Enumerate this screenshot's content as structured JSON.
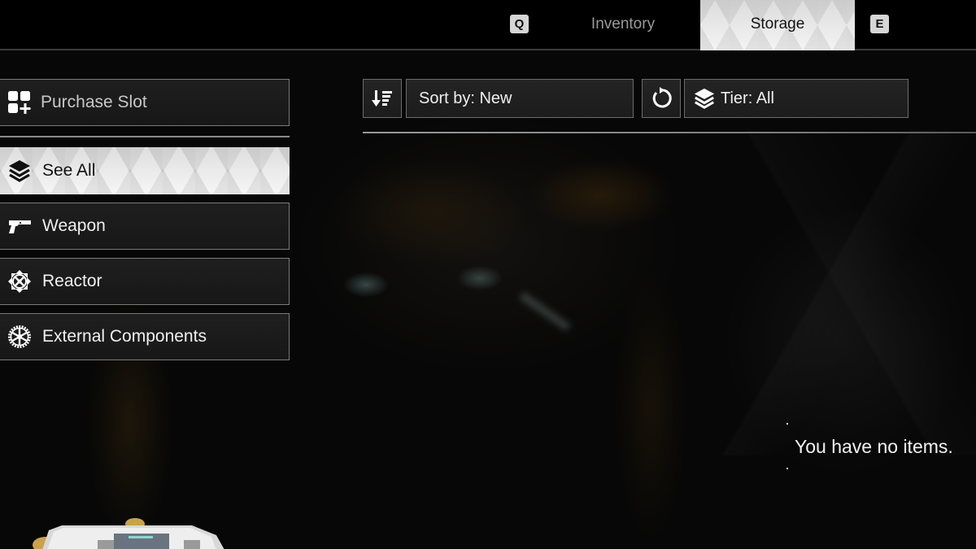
{
  "top_tabs": {
    "prev_key": "Q",
    "next_key": "E",
    "tabs": [
      {
        "label": "Inventory",
        "active": false
      },
      {
        "label": "Storage",
        "active": true
      }
    ]
  },
  "sidebar": {
    "purchase_slot": {
      "label": "Purchase Slot",
      "icon": "grid-plus-icon"
    },
    "categories": [
      {
        "label": "See All",
        "icon": "layers-icon",
        "active": true
      },
      {
        "label": "Weapon",
        "icon": "pistol-icon",
        "active": false
      },
      {
        "label": "Reactor",
        "icon": "reactor-icon",
        "active": false
      },
      {
        "label": "External Components",
        "icon": "gear-wheel-icon",
        "active": false
      }
    ]
  },
  "toolbar": {
    "sort_order_icon": "sort-descending-icon",
    "sort_label": "Sort by: New",
    "reset_icon": "refresh-icon",
    "tier_icon": "layers-icon",
    "tier_label": "Tier: All"
  },
  "content": {
    "empty_message": "You have no items."
  }
}
